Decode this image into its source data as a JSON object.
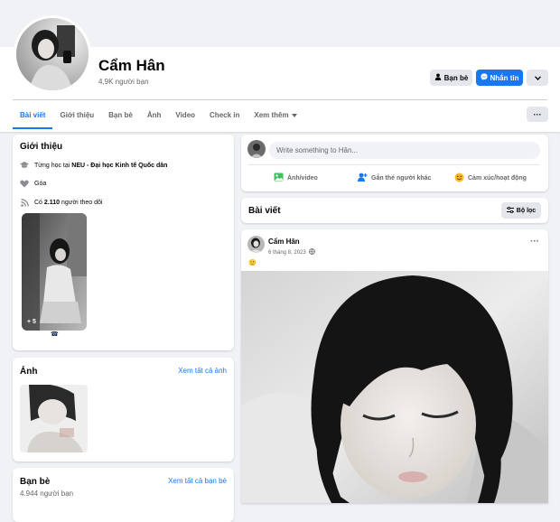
{
  "profile": {
    "name": "Cẩm Hân",
    "friends": "4,9K người bạn"
  },
  "actions": {
    "friends_label": "Bạn bè",
    "message_label": "Nhắn tin"
  },
  "tabs": [
    {
      "label": "Bài viết"
    },
    {
      "label": "Giới thiệu"
    },
    {
      "label": "Bạn bè"
    },
    {
      "label": "Ảnh"
    },
    {
      "label": "Video"
    },
    {
      "label": "Check in"
    },
    {
      "label": "Xem thêm"
    }
  ],
  "intro": {
    "title": "Giới thiệu",
    "study_prefix": "Từng học tại",
    "study_school": "NEU - Đại học Kinh tế Quốc dân",
    "relationship": "Góa",
    "followers_prefix": "Có",
    "followers_count": "2.110",
    "followers_suffix": "người theo dõi",
    "featured_more": "+ 5"
  },
  "photos": {
    "title": "Ảnh",
    "see_all": "Xem tất cả ảnh"
  },
  "friends_card": {
    "title": "Bạn bè",
    "count": "4.944 người bạn",
    "see_all": "Xem tất cả bạn bè"
  },
  "composer": {
    "placeholder": "Write something to Hân...",
    "photo_label": "Ảnh/video",
    "tag_label": "Gắn thẻ người khác",
    "feeling_label": "Cảm xúc/hoạt động"
  },
  "posts_header": {
    "title": "Bài viết",
    "filter_label": "Bộ lọc"
  },
  "post": {
    "author": "Cẩm Hân",
    "date": "6 tháng 8, 2023",
    "emoji": "🙂"
  },
  "colors": {
    "accent": "#1877f2",
    "page_bg": "#f0f2f5",
    "secondary_text": "#65676b"
  }
}
